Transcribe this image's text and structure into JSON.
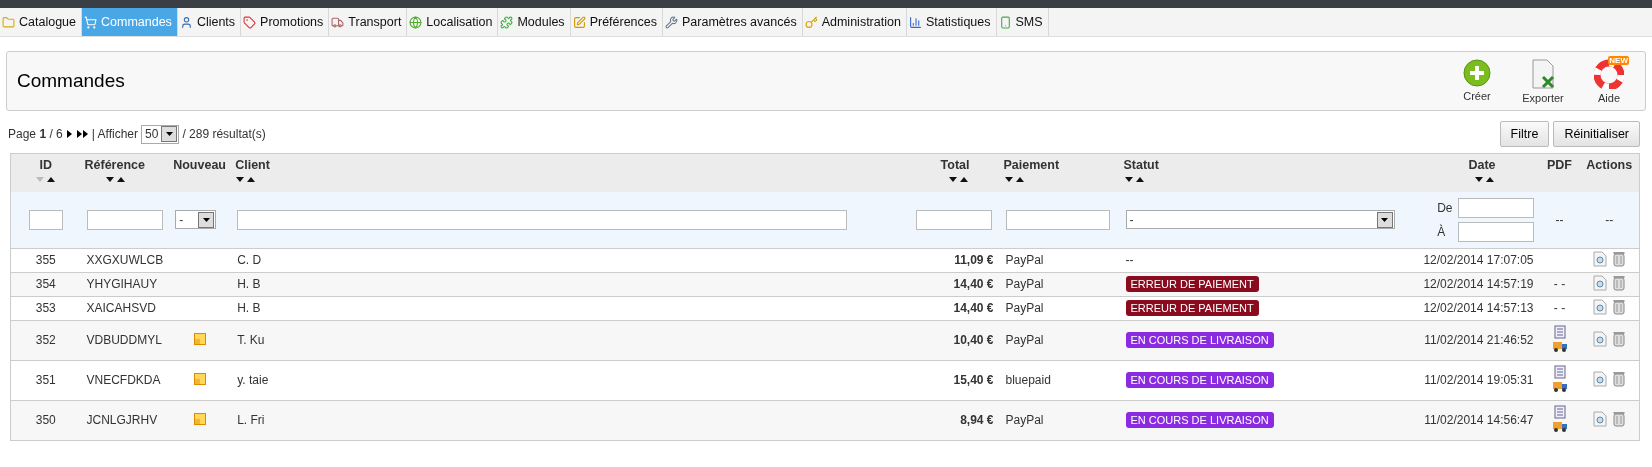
{
  "tabs": [
    {
      "label": "Catalogue",
      "selected": false
    },
    {
      "label": "Commandes",
      "selected": true
    },
    {
      "label": "Clients",
      "selected": false
    },
    {
      "label": "Promotions",
      "selected": false
    },
    {
      "label": "Transport",
      "selected": false
    },
    {
      "label": "Localisation",
      "selected": false
    },
    {
      "label": "Modules",
      "selected": false
    },
    {
      "label": "Préférences",
      "selected": false
    },
    {
      "label": "Paramètres avancés",
      "selected": false
    },
    {
      "label": "Administration",
      "selected": false
    },
    {
      "label": "Statistiques",
      "selected": false
    },
    {
      "label": "SMS",
      "selected": false
    }
  ],
  "header": {
    "title": "Commandes",
    "actions": [
      {
        "kind": "create",
        "label": "Créer"
      },
      {
        "kind": "export",
        "label": "Exporter"
      },
      {
        "kind": "help",
        "label": "Aide",
        "badge": "NEW"
      }
    ]
  },
  "pagination": {
    "page_label": "Page",
    "page": "1",
    "pages": "/ 6",
    "show_label": "| Afficher",
    "per_page": "50",
    "results": "/ 289 résultat(s)"
  },
  "buttons": [
    "Filtre",
    "Réinitialiser"
  ],
  "table": {
    "columns": [
      {
        "label": "ID",
        "sortable": true,
        "sorted_desc": true
      },
      {
        "label": "Référence",
        "sortable": true,
        "sorted_desc": false
      },
      {
        "label": "Nouveau",
        "sortable": false
      },
      {
        "label": "Client",
        "sortable": true,
        "sorted_desc": false
      },
      {
        "label": "Total",
        "sortable": true,
        "sorted_desc": false
      },
      {
        "label": "Paiement",
        "sortable": true,
        "sorted_desc": false
      },
      {
        "label": "Statut",
        "sortable": true,
        "sorted_desc": false
      },
      {
        "label": "Date",
        "sortable": true,
        "sorted_desc": false
      },
      {
        "label": "PDF",
        "sortable": false
      },
      {
        "label": "Actions",
        "sortable": false
      }
    ],
    "filters": {
      "new_select": "-",
      "status_select": "-",
      "date_from_label": "De",
      "date_to_label": "À",
      "pdf": "--",
      "actions": "--"
    },
    "rows": [
      {
        "id": "355",
        "reference": "XXGXUWLCB",
        "new": false,
        "client": "C. D",
        "total": "11,09 €",
        "payment": "PayPal",
        "status": {
          "label": "--"
        },
        "date": "12/02/2014 17:07:05"
      },
      {
        "id": "354",
        "reference": "YHYGIHAUY",
        "new": false,
        "client": "H. B",
        "total": "14,40 €",
        "payment": "PayPal",
        "status": {
          "label": "ERREUR DE PAIEMENT",
          "color": "#8a0b1e"
        },
        "date": "12/02/2014 14:57:19",
        "pdf": {
          "kind": "text",
          "text": "- -"
        }
      },
      {
        "id": "353",
        "reference": "XAICAHSVD",
        "new": false,
        "client": "H. B",
        "total": "14,40 €",
        "payment": "PayPal",
        "status": {
          "label": "ERREUR DE PAIEMENT",
          "color": "#8a0b1e"
        },
        "date": "12/02/2014 14:57:13",
        "pdf": {
          "kind": "text",
          "text": "- -"
        }
      },
      {
        "id": "352",
        "reference": "VDBUDDMYL",
        "new": true,
        "client": "T. Ku",
        "total": "10,40 €",
        "payment": "PayPal",
        "status": {
          "label": "EN COURS DE LIVRAISON",
          "color": "#8a2be2"
        },
        "date": "11/02/2014 21:46:52",
        "pdf": {
          "kind": "documents"
        }
      },
      {
        "id": "351",
        "reference": "VNECFDKDA",
        "new": true,
        "client": "y. taie",
        "total": "15,40 €",
        "payment": "bluepaid",
        "status": {
          "label": "EN COURS DE LIVRAISON",
          "color": "#8a2be2"
        },
        "date": "11/02/2014 19:05:31",
        "pdf": {
          "kind": "documents"
        }
      },
      {
        "id": "350",
        "reference": "JCNLGJRHV",
        "new": true,
        "client": "L. Fri",
        "total": "8,94 €",
        "payment": "PayPal",
        "status": {
          "label": "EN COURS DE LIVRAISON",
          "color": "#8a2be2"
        },
        "date": "11/02/2014 14:56:47",
        "pdf": {
          "kind": "documents"
        }
      }
    ]
  }
}
